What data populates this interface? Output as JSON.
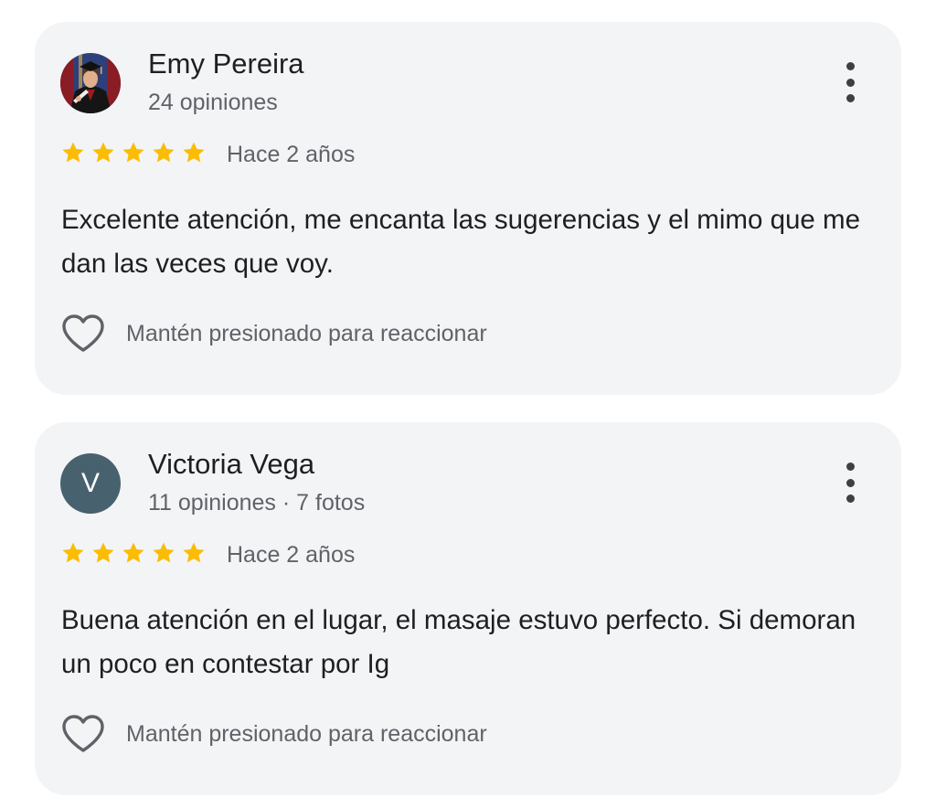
{
  "reviews": [
    {
      "author": "Emy Pereira",
      "avatar": "profile-photo",
      "meta": "24 opiniones",
      "rating": 5,
      "time": "Hace 2 años",
      "text": "Excelente atención, me encanta las sugerencias y el mimo que me dan las veces que voy.",
      "reaction_hint": "Mantén presionado para reaccionar"
    },
    {
      "author": "Victoria Vega",
      "avatar_letter": "V",
      "meta": "11 opiniones · 7 fotos",
      "rating": 5,
      "time": "Hace 2 años",
      "text": "Buena atención en el lugar, el masaje estuvo perfecto. Si demoran un poco en contestar por Ig",
      "reaction_hint": "Mantén presionado para reaccionar"
    }
  ],
  "colors": {
    "card_bg": "#f3f4f6",
    "star": "#fbbc04",
    "avatar_letter_bg": "#48616f",
    "primary_text": "#1f1f1f",
    "secondary_text": "#5f6368"
  },
  "icons": {
    "menu": "more-vert-icon",
    "star": "star-icon",
    "reaction": "heart-outline-icon"
  }
}
